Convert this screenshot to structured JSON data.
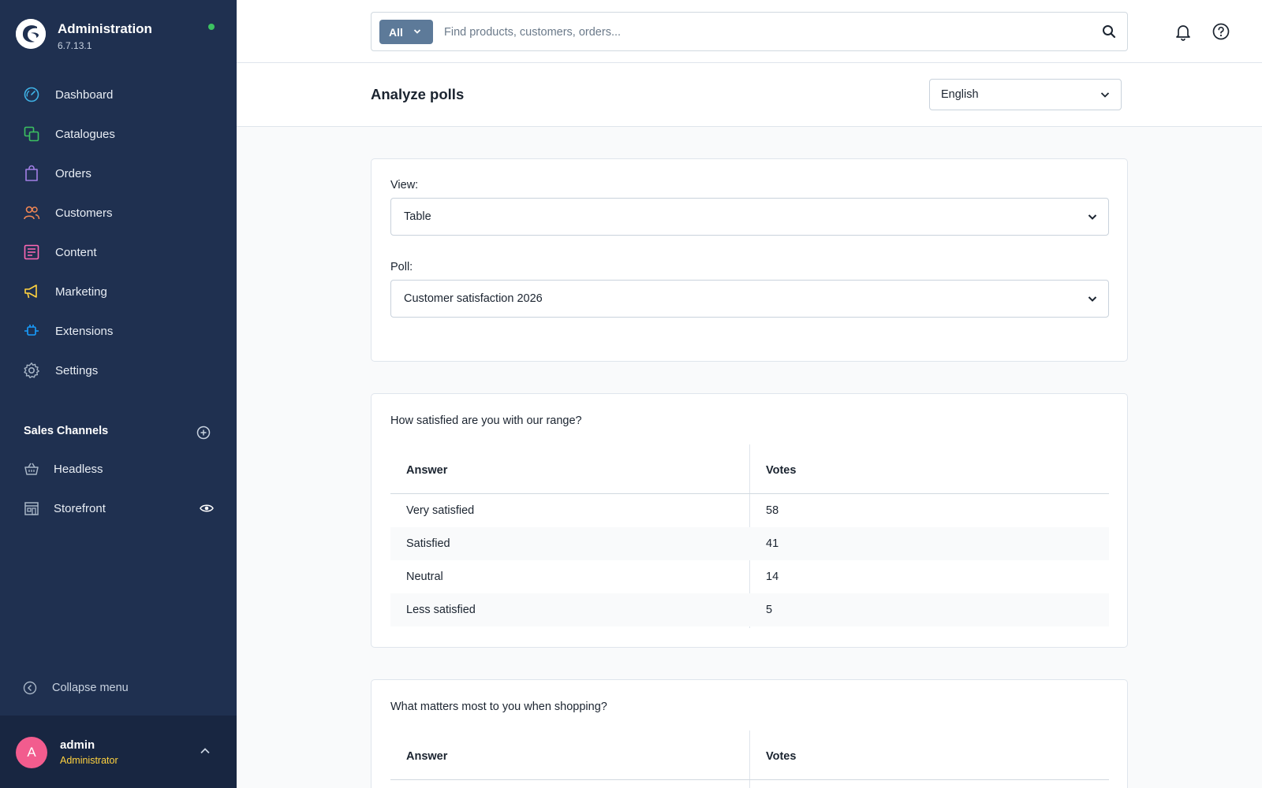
{
  "app": {
    "title": "Administration",
    "version": "6.7.13.1",
    "status_color": "#3cc261",
    "sidebar_bg": "#1f3050"
  },
  "nav": {
    "items": [
      {
        "label": "Dashboard",
        "icon": "dashboard-gauge-icon",
        "color": "#3fb2e6"
      },
      {
        "label": "Catalogues",
        "icon": "catalogue-icon",
        "color": "#3cc261"
      },
      {
        "label": "Orders",
        "icon": "shopping-bag-icon",
        "color": "#a27fe6"
      },
      {
        "label": "Customers",
        "icon": "customers-icon",
        "color": "#f48854"
      },
      {
        "label": "Content",
        "icon": "content-icon",
        "color": "#ff68b4"
      },
      {
        "label": "Marketing",
        "icon": "megaphone-icon",
        "color": "#ffd23f"
      },
      {
        "label": "Extensions",
        "icon": "plug-icon",
        "color": "#189eff"
      },
      {
        "label": "Settings",
        "icon": "gear-icon",
        "color": "#a7b5c6"
      }
    ]
  },
  "sales_channels": {
    "title": "Sales Channels",
    "items": [
      {
        "label": "Headless",
        "icon": "basket-icon"
      },
      {
        "label": "Storefront",
        "icon": "storefront-icon"
      }
    ]
  },
  "collapse_label": "Collapse menu",
  "user": {
    "initial": "A",
    "name": "admin",
    "role": "Administrator"
  },
  "search": {
    "type_label": "All",
    "placeholder": "Find products, customers, orders..."
  },
  "page": {
    "title": "Analyze polls",
    "language": "English"
  },
  "filters": {
    "view_label": "View:",
    "view_value": "Table",
    "poll_label": "Poll:",
    "poll_value": "Customer satisfaction 2026"
  },
  "questions": [
    {
      "question": "How satisfied are you with our range?",
      "columns": [
        "Answer",
        "Votes"
      ],
      "rows": [
        [
          "Very satisfied",
          "58"
        ],
        [
          "Satisfied",
          "41"
        ],
        [
          "Neutral",
          "14"
        ],
        [
          "Less satisfied",
          "5"
        ]
      ]
    },
    {
      "question": "What matters most to you when shopping?",
      "columns": [
        "Answer",
        "Votes"
      ],
      "rows": []
    }
  ]
}
